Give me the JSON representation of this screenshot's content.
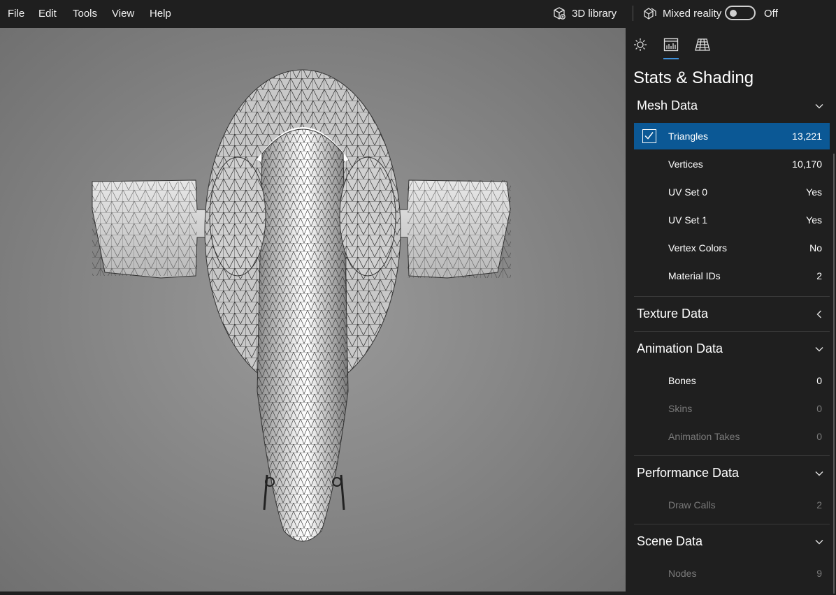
{
  "menu": [
    "File",
    "Edit",
    "Tools",
    "View",
    "Help"
  ],
  "toolbar": {
    "library_label": "3D library",
    "mixed_reality_label": "Mixed reality",
    "toggle_state": "Off"
  },
  "panel": {
    "title": "Stats & Shading",
    "tabs": [
      "lighting-icon",
      "stats-icon",
      "grid-icon"
    ],
    "active_tab": "stats-icon",
    "sections": {
      "mesh": {
        "label": "Mesh Data",
        "expanded": true,
        "rows": [
          {
            "name": "Triangles",
            "value": "13,221",
            "checked": true,
            "selected": true
          },
          {
            "name": "Vertices",
            "value": "10,170"
          },
          {
            "name": "UV Set 0",
            "value": "Yes"
          },
          {
            "name": "UV Set 1",
            "value": "Yes"
          },
          {
            "name": "Vertex Colors",
            "value": "No"
          },
          {
            "name": "Material IDs",
            "value": "2"
          }
        ]
      },
      "texture": {
        "label": "Texture Data",
        "expanded": false
      },
      "animation": {
        "label": "Animation Data",
        "expanded": true,
        "rows": [
          {
            "name": "Bones",
            "value": "0"
          },
          {
            "name": "Skins",
            "value": "0",
            "disabled": true
          },
          {
            "name": "Animation Takes",
            "value": "0",
            "disabled": true
          }
        ]
      },
      "performance": {
        "label": "Performance Data",
        "expanded": true,
        "rows": [
          {
            "name": "Draw Calls",
            "value": "2",
            "disabled": true
          }
        ]
      },
      "scene": {
        "label": "Scene Data",
        "expanded": true,
        "rows": [
          {
            "name": "Nodes",
            "value": "9",
            "disabled": true
          }
        ]
      }
    }
  },
  "colors": {
    "background": "#1f1f1f",
    "accent": "#3f8fd8",
    "selected_row": "#0b5895",
    "viewport": "#8a8a8a"
  }
}
